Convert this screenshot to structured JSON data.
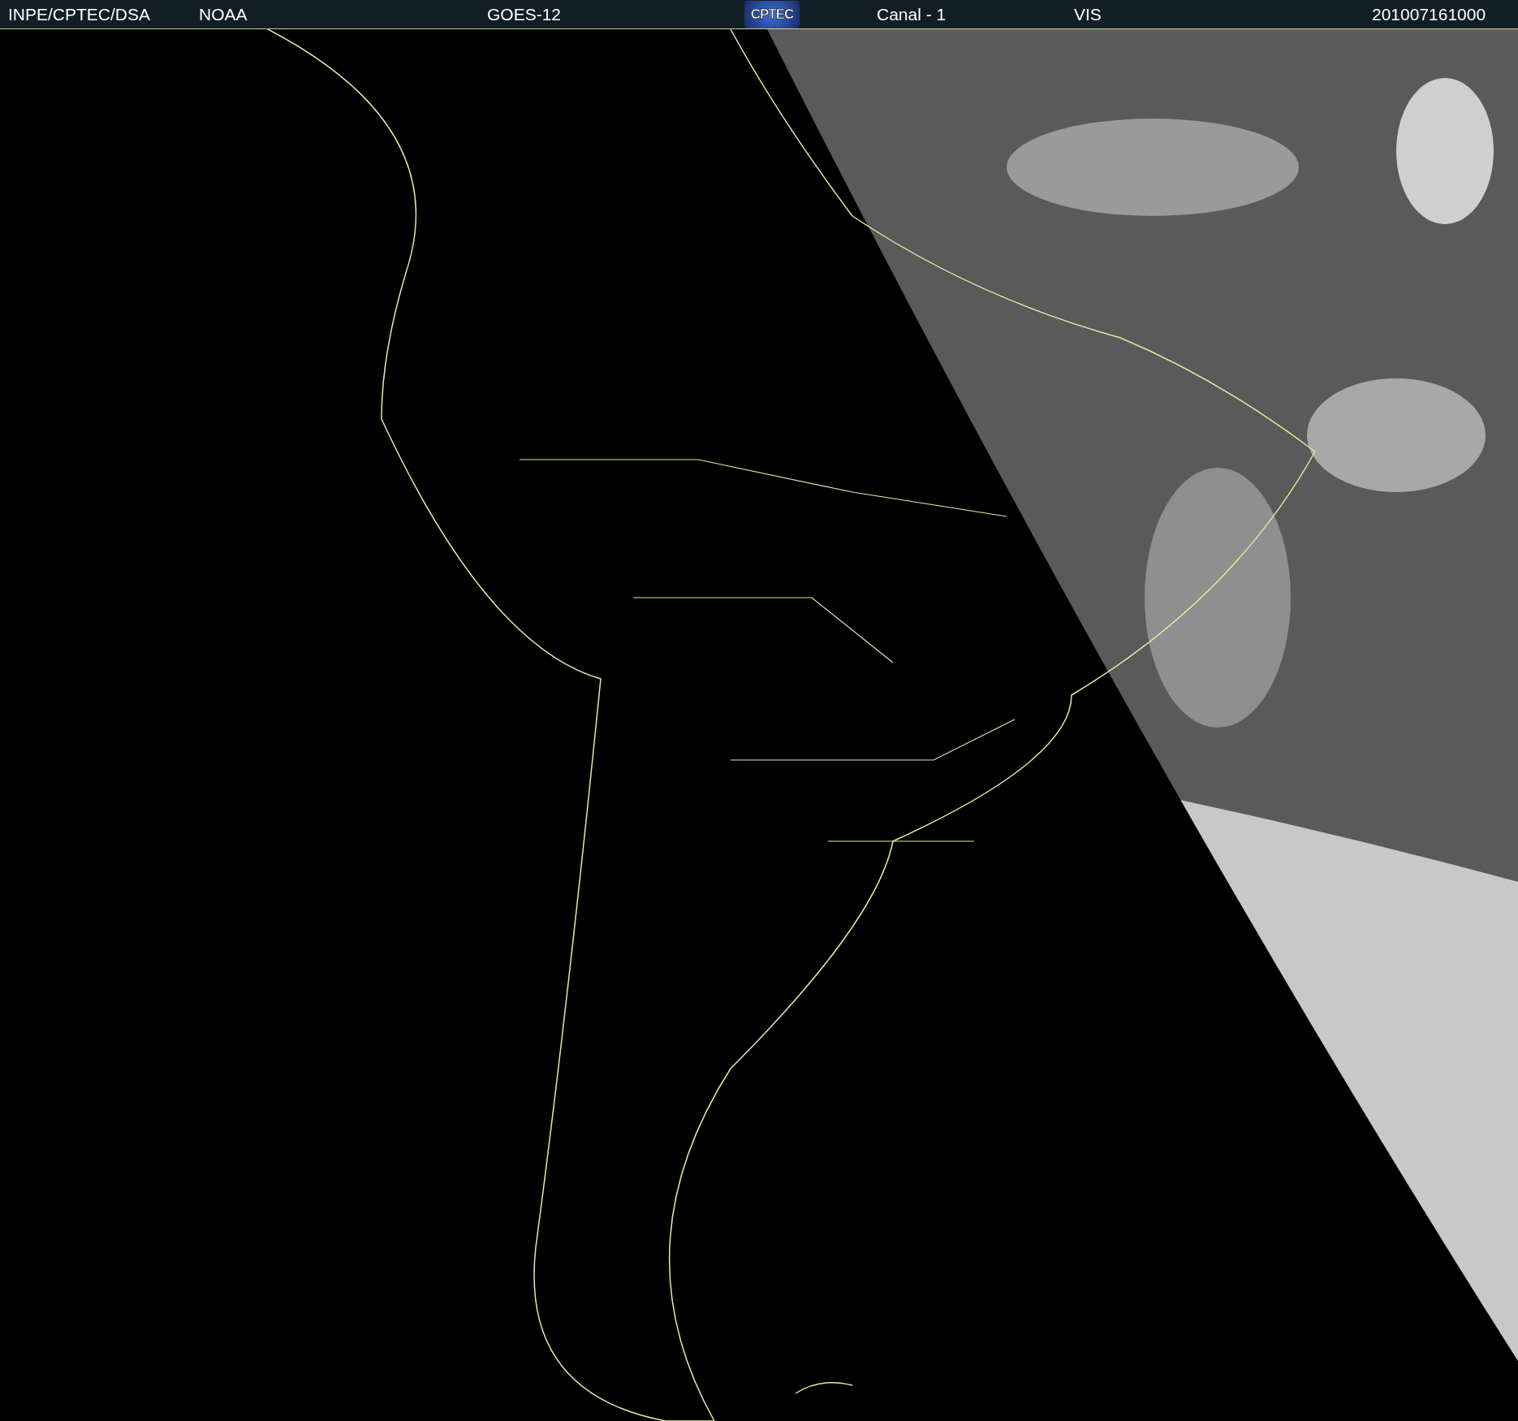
{
  "header": {
    "items": [
      {
        "kind": "text",
        "text": "INPE/CPTEC/DSA"
      },
      {
        "kind": "text",
        "text": "NOAA"
      },
      {
        "kind": "text",
        "text": "GOES-12"
      },
      {
        "kind": "logo",
        "text": "CPTEC"
      },
      {
        "kind": "text",
        "text": "Canal - 1"
      },
      {
        "kind": "text",
        "text": "VIS"
      },
      {
        "kind": "text",
        "text": "201007161000"
      }
    ]
  }
}
